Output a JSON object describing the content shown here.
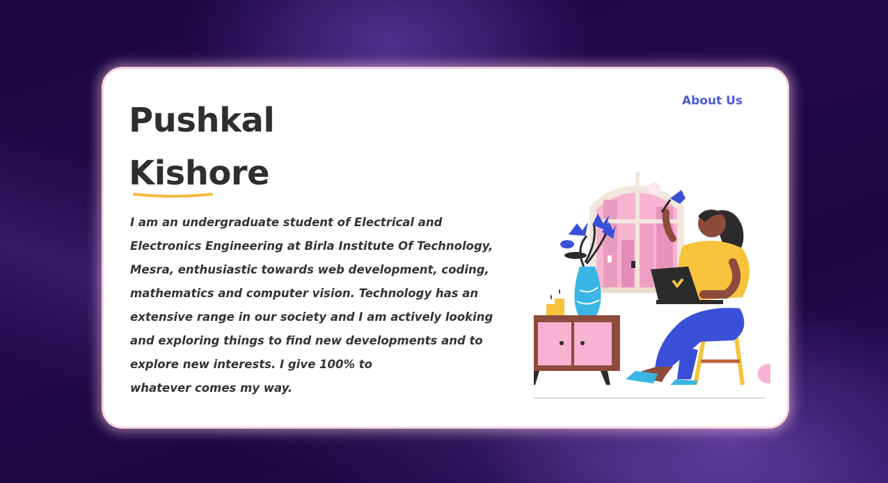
{
  "nav": {
    "about_label": "About Us"
  },
  "hero": {
    "name_first": "Pushkal",
    "name_last": "Kishore",
    "bio": "I am an undergraduate student of Electrical and\nElectronics Engineering at Birla Institute Of Technology,\nMesra, enthusiastic towards web development, coding,\nmathematics and computer vision. Technology has an\nextensive range in our society and I am actively looking\nand exploring things to find new developments and to\nexplore new interests. I give 100% to\nwhatever comes my way."
  },
  "icons": {
    "underline": "underline-accent",
    "illustration": "woman-with-laptop-illustration"
  },
  "colors": {
    "accent_link": "#4a5bd8",
    "underline": "#f6b93b",
    "text": "#333333",
    "card_glow": "#f7d3e0"
  }
}
